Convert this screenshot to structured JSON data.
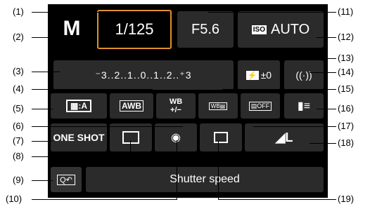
{
  "mode": "M",
  "shutter": "1/125",
  "aperture": "F5.6",
  "iso": {
    "badge": "ISO",
    "value": "AUTO"
  },
  "exposure_scale": "⁻3..2..1..0..1..2..⁺3",
  "flash_comp": {
    "value": "±0"
  },
  "wireless": "((·))",
  "white_balance": "AWB",
  "wb_shift": {
    "top": "WB",
    "bottom": "+/−"
  },
  "picture_style": "A",
  "alo": "OFF",
  "af_operation": "ONE SHOT",
  "drive_quality": "L",
  "status_text": "Shutter speed",
  "callouts": {
    "c1": "(1)",
    "c2": "(2)",
    "c3": "(3)",
    "c4": "(4)",
    "c5": "(5)",
    "c6": "(6)",
    "c7": "(7)",
    "c8": "(8)",
    "c9": "(9)",
    "c10": "(10)",
    "c11": "(11)",
    "c12": "(12)",
    "c13": "(13)",
    "c14": "(14)",
    "c15": "(15)",
    "c16": "(16)",
    "c17": "(17)",
    "c18": "(18)",
    "c19": "(19)"
  },
  "colors": {
    "accent": "#e0902a",
    "cell": "#2b2b2b",
    "screen": "#000000"
  }
}
